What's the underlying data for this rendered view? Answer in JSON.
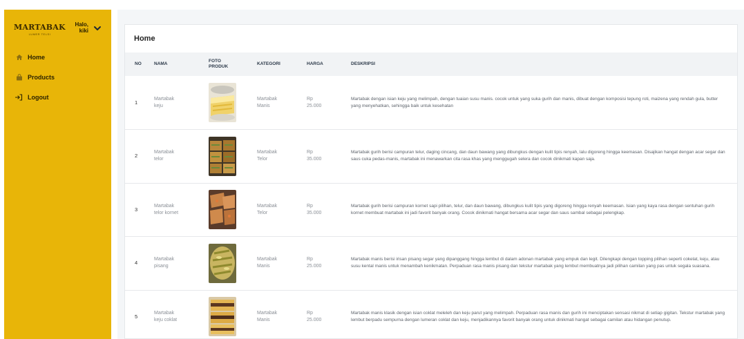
{
  "brand": {
    "name": "MARTABAK",
    "tagline": "LUMER TELSI"
  },
  "user": {
    "greeting": "Halo,",
    "name": "kiki"
  },
  "nav": [
    {
      "label": "Home",
      "icon": "home-icon"
    },
    {
      "label": "Products",
      "icon": "bag-icon"
    },
    {
      "label": "Logout",
      "icon": "logout-icon"
    }
  ],
  "page": {
    "title": "Home"
  },
  "table": {
    "headers": {
      "no": "NO",
      "nama": "NAMA",
      "foto_line1": "FOTO",
      "foto_line2": "PRODUK",
      "kategori": "KATEGORI",
      "harga": "HARGA",
      "deskripsi": "DESKRIPSI"
    },
    "rows": [
      {
        "no": "1",
        "nama_l1": "Martabak",
        "nama_l2": "keju",
        "kategori_l1": "Martabak",
        "kategori_l2": "Manis",
        "harga_l1": "Rp",
        "harga_l2": "25.000",
        "deskripsi": "Martabak dengan isian keju yang melimpah, dengan tuaian susu manis. cocok untuk yang suka gurih dan manis, dibuat dengan komposisi tepung roti, maizena yang rendah gula, butter yang menyehatkan, sehingga baik untuk kesehatan"
      },
      {
        "no": "2",
        "nama_l1": "Martabak",
        "nama_l2": "telor",
        "kategori_l1": "Martabak",
        "kategori_l2": "Telor",
        "harga_l1": "Rp",
        "harga_l2": "35.000",
        "deskripsi": "Martabak gurih berisi campuran telur, daging cincang, dan daun bawang yang dibungkus dengan kulit tipis renyah, lalu digoreng hingga keemasan. Disajikan hangat dengan acar segar dan saus cuka pedas-manis, martabak ini menawarkan cita rasa khas yang menggugah selera dan cocok dinikmati kapan saja."
      },
      {
        "no": "3",
        "nama_l1": "Martabak",
        "nama_l2": "telor kornet",
        "kategori_l1": "Martabak",
        "kategori_l2": "Telor",
        "harga_l1": "Rp",
        "harga_l2": "35.000",
        "deskripsi": "Martabak gurih berisi campuran kornet sapi pilihan, telur, dan daun bawang, dibungkus kulit tipis yang digoreng hingga renyah keemasan. Isian yang kaya rasa dengan sentuhan gurih kornet membuat martabak ini jadi favorit banyak orang. Cocok dinikmati hangat bersama acar segar dan saus sambal sebagai pelengkap."
      },
      {
        "no": "4",
        "nama_l1": "Martabak",
        "nama_l2": "pisang",
        "kategori_l1": "Martabak",
        "kategori_l2": "Manis",
        "harga_l1": "Rp",
        "harga_l2": "25.000",
        "deskripsi": "Martabak manis berisi irisan pisang segar yang dipanggang hingga lembut di dalam adonan martabak yang empuk dan legit. Dilengkapi dengan topping pilihan seperti cokelat, keju, atau susu kental manis untuk menambah kenikmatan. Perpaduan rasa manis pisang dan tekstur martabak yang lembut membuatnya jadi pilihan camilan yang pas untuk segala suasana."
      },
      {
        "no": "5",
        "nama_l1": "Martabak",
        "nama_l2": "keju coklat",
        "kategori_l1": "Martabak",
        "kategori_l2": "Manis",
        "harga_l1": "Rp",
        "harga_l2": "25.000",
        "deskripsi": "Martabak manis klasik dengan isian coklat meleleh dan keju parut yang melimpah. Perpaduan rasa manis dan gurih ini menciptakan sensasi nikmat di setiap gigitan. Tekstur martabak yang lembut berpadu sempurna dengan lumeran coklat dan keju, menjadikannya favorit banyak orang untuk dinikmati hangat sebagai camilan atau hidangan penutup."
      }
    ]
  }
}
